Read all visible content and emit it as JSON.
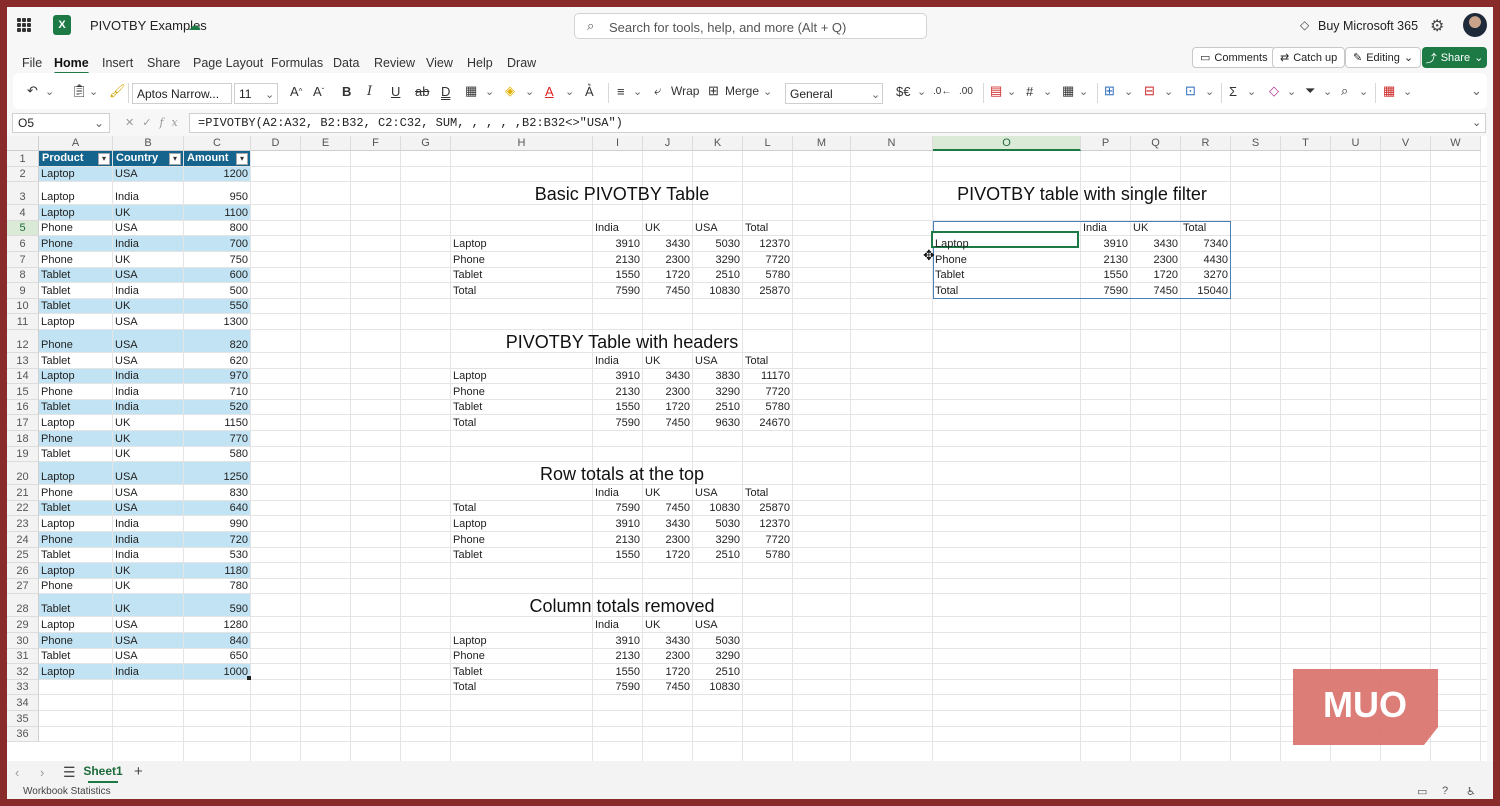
{
  "titlebar": {
    "doc_title": "PIVOTBY Examples",
    "search_placeholder": "Search for tools, help, and more (Alt + Q)",
    "buy_label": "Buy Microsoft 365"
  },
  "menu": {
    "tabs": [
      "File",
      "Home",
      "Insert",
      "Share",
      "Page Layout",
      "Formulas",
      "Data",
      "Review",
      "View",
      "Help",
      "Draw"
    ],
    "active": "Home",
    "comments_label": "Comments",
    "catchup_label": "Catch up",
    "editing_label": "Editing",
    "share_label": "Share"
  },
  "ribbon": {
    "font_name": "Aptos Narrow...",
    "font_size": "11",
    "wrap_label": "Wrap",
    "merge_label": "Merge",
    "number_format": "General"
  },
  "formula_bar": {
    "name_box": "O5",
    "formula": "=PIVOTBY(A2:A32, B2:B32, C2:C32, SUM, , , , ,B2:B32<>\"USA\")"
  },
  "grid": {
    "selected_cell": "O5",
    "columns": [
      "A",
      "B",
      "C",
      "D",
      "E",
      "F",
      "G",
      "H",
      "I",
      "J",
      "K",
      "L",
      "M",
      "N",
      "O",
      "P",
      "Q",
      "R",
      "S",
      "T",
      "U",
      "V",
      "W"
    ],
    "rows": [
      "1",
      "2",
      "3",
      "4",
      "5",
      "6",
      "7",
      "8",
      "9",
      "10",
      "11",
      "12",
      "13",
      "14",
      "15",
      "16",
      "17",
      "18",
      "19",
      "20",
      "21",
      "22",
      "23",
      "24",
      "25",
      "26",
      "27",
      "28",
      "29",
      "30",
      "31",
      "32",
      "33",
      "34",
      "35",
      "36"
    ]
  },
  "source_table": {
    "headers": [
      "Product",
      "Country",
      "Amount"
    ],
    "rows": [
      [
        "Laptop",
        "USA",
        "1200"
      ],
      [
        "Laptop",
        "India",
        "950"
      ],
      [
        "Laptop",
        "UK",
        "1100"
      ],
      [
        "Phone",
        "USA",
        "800"
      ],
      [
        "Phone",
        "India",
        "700"
      ],
      [
        "Phone",
        "UK",
        "750"
      ],
      [
        "Tablet",
        "USA",
        "600"
      ],
      [
        "Tablet",
        "India",
        "500"
      ],
      [
        "Tablet",
        "UK",
        "550"
      ],
      [
        "Laptop",
        "USA",
        "1300"
      ],
      [
        "Phone",
        "USA",
        "820"
      ],
      [
        "Tablet",
        "USA",
        "620"
      ],
      [
        "Laptop",
        "India",
        "970"
      ],
      [
        "Phone",
        "India",
        "710"
      ],
      [
        "Tablet",
        "India",
        "520"
      ],
      [
        "Laptop",
        "UK",
        "1150"
      ],
      [
        "Phone",
        "UK",
        "770"
      ],
      [
        "Tablet",
        "UK",
        "580"
      ],
      [
        "Laptop",
        "USA",
        "1250"
      ],
      [
        "Phone",
        "USA",
        "830"
      ],
      [
        "Tablet",
        "USA",
        "640"
      ],
      [
        "Laptop",
        "India",
        "990"
      ],
      [
        "Phone",
        "India",
        "720"
      ],
      [
        "Tablet",
        "India",
        "530"
      ],
      [
        "Laptop",
        "UK",
        "1180"
      ],
      [
        "Phone",
        "UK",
        "780"
      ],
      [
        "Tablet",
        "UK",
        "590"
      ],
      [
        "Laptop",
        "USA",
        "1280"
      ],
      [
        "Phone",
        "USA",
        "840"
      ],
      [
        "Tablet",
        "USA",
        "650"
      ],
      [
        "Laptop",
        "India",
        "1000"
      ]
    ]
  },
  "pivots": [
    {
      "title": "Basic PIVOTBY Table",
      "headers": [
        "India",
        "UK",
        "USA",
        "Total"
      ],
      "rows": [
        [
          "Laptop",
          "3910",
          "3430",
          "5030",
          "12370"
        ],
        [
          "Phone",
          "2130",
          "2300",
          "3290",
          "7720"
        ],
        [
          "Tablet",
          "1550",
          "1720",
          "2510",
          "5780"
        ],
        [
          "Total",
          "7590",
          "7450",
          "10830",
          "25870"
        ]
      ]
    },
    {
      "title": "PIVOTBY Table with headers",
      "headers": [
        "India",
        "UK",
        "USA",
        "Total"
      ],
      "rows": [
        [
          "Laptop",
          "3910",
          "3430",
          "3830",
          "11170"
        ],
        [
          "Phone",
          "2130",
          "2300",
          "3290",
          "7720"
        ],
        [
          "Tablet",
          "1550",
          "1720",
          "2510",
          "5780"
        ],
        [
          "Total",
          "7590",
          "7450",
          "9630",
          "24670"
        ]
      ]
    },
    {
      "title": "Row totals at the top",
      "headers": [
        "India",
        "UK",
        "USA",
        "Total"
      ],
      "rows": [
        [
          "Total",
          "7590",
          "7450",
          "10830",
          "25870"
        ],
        [
          "Laptop",
          "3910",
          "3430",
          "5030",
          "12370"
        ],
        [
          "Phone",
          "2130",
          "2300",
          "3290",
          "7720"
        ],
        [
          "Tablet",
          "1550",
          "1720",
          "2510",
          "5780"
        ]
      ]
    },
    {
      "title": "Column totals removed",
      "headers": [
        "India",
        "UK",
        "USA"
      ],
      "rows": [
        [
          "Laptop",
          "3910",
          "3430",
          "5030"
        ],
        [
          "Phone",
          "2130",
          "2300",
          "3290"
        ],
        [
          "Tablet",
          "1550",
          "1720",
          "2510"
        ],
        [
          "Total",
          "7590",
          "7450",
          "10830"
        ]
      ]
    },
    {
      "title": "PIVOTBY table with single filter",
      "headers": [
        "India",
        "UK",
        "Total"
      ],
      "rows": [
        [
          "Laptop",
          "3910",
          "3430",
          "7340"
        ],
        [
          "Phone",
          "2130",
          "2300",
          "4430"
        ],
        [
          "Tablet",
          "1550",
          "1720",
          "3270"
        ],
        [
          "Total",
          "7590",
          "7450",
          "15040"
        ]
      ]
    }
  ],
  "sheets": {
    "tabs": [
      "Sheet1"
    ],
    "active": "Sheet1"
  },
  "status": {
    "left": "Workbook Statistics"
  },
  "watermark": {
    "text": "MUO"
  },
  "colors": {
    "excel_green": "#1d7a45",
    "table_header": "#14648e",
    "table_band": "#c2e3f3",
    "selection_outline": "#4a7fb8"
  }
}
